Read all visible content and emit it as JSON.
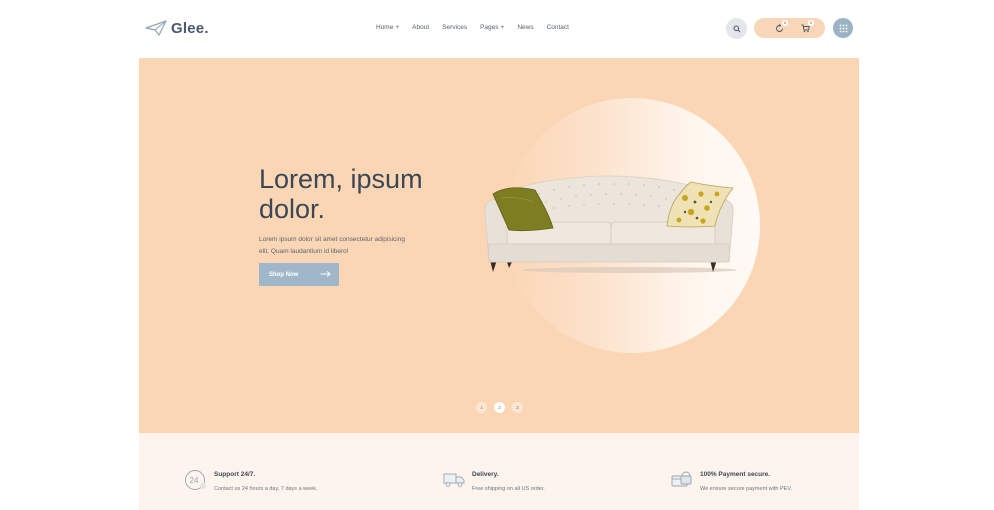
{
  "brand": {
    "name": "Glee."
  },
  "nav": {
    "items": [
      {
        "label": "Home",
        "suffix": "+"
      },
      {
        "label": "About",
        "suffix": ""
      },
      {
        "label": "Services",
        "suffix": ""
      },
      {
        "label": "Pages",
        "suffix": "+"
      },
      {
        "label": "News",
        "suffix": ""
      },
      {
        "label": "Contact",
        "suffix": ""
      }
    ]
  },
  "header": {
    "wishlist_count": "0",
    "cart_count": "0"
  },
  "hero": {
    "title": "Lorem, ipsum dolor.",
    "description": "Lorem ipsum dolor sit amet consectetur adipisicing elit. Quam laudantium id libero!",
    "button_label": "Shop Now",
    "slides": [
      "1",
      "2",
      "3"
    ],
    "active_slide": 2
  },
  "features": [
    {
      "icon": "support-24-icon",
      "title": "Support 24/7.",
      "description": "Contact us 24 hours a day, 7 days a week."
    },
    {
      "icon": "delivery-truck-icon",
      "title": "Delivery.",
      "description": "Free shipping on all US order."
    },
    {
      "icon": "secure-payment-icon",
      "title": "100% Payment secure.",
      "description": "We ensure secure payment with PEV."
    }
  ],
  "colors": {
    "hero_bg": "#fbd6b5",
    "accent_button": "#9fb7c8",
    "features_bg": "#fdf5ed",
    "pill_bg": "#f8d7b8"
  }
}
